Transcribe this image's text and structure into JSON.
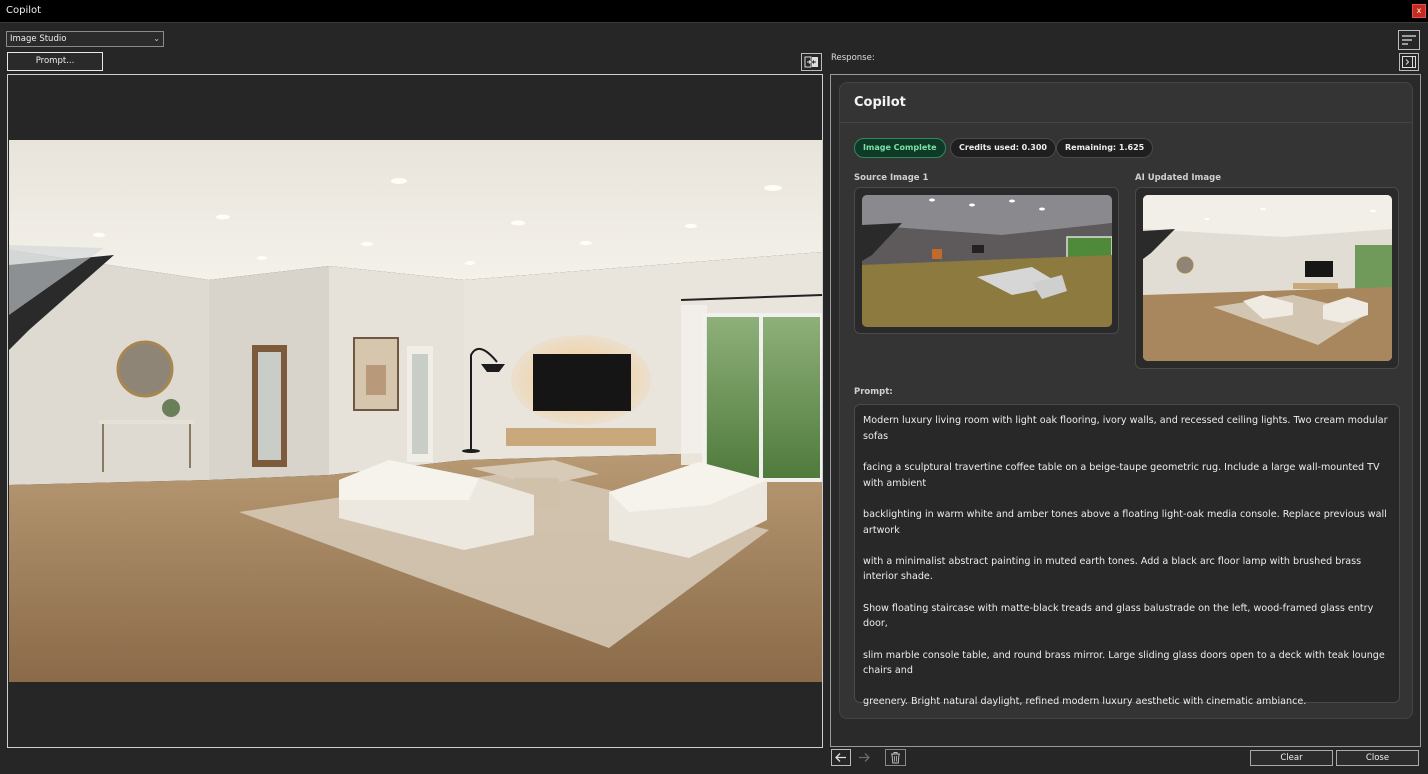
{
  "window": {
    "title": "Copilot",
    "close_glyph": "x"
  },
  "toolbar": {
    "mode_value": "Image Studio",
    "prompt_button": "Prompt..."
  },
  "response": {
    "label": "Response:"
  },
  "card": {
    "title": "Copilot",
    "status": "Image Complete",
    "credits_used": "Credits used: 0.300",
    "remaining": "Remaining: 1.625",
    "source_label": "Source Image 1",
    "ai_label": "AI Updated Image",
    "prompt_label": "Prompt:",
    "prompt_paragraphs": [
      "Modern luxury living room with light oak flooring, ivory walls, and recessed ceiling lights. Two cream modular sofas",
      "facing a sculptural travertine coffee table on a beige-taupe geometric rug. Include a large wall-mounted TV with ambient",
      "backlighting in warm white and amber tones above a floating light-oak media console. Replace previous wall artwork",
      "with a minimalist abstract painting in muted earth tones. Add a black arc floor lamp with brushed brass interior shade.",
      "Show floating staircase with matte-black treads and glass balustrade on the left, wood-framed glass entry door,",
      "slim marble console table, and round brass mirror. Large sliding glass doors open to a deck with teak lounge chairs and",
      "greenery. Bright natural daylight, refined modern luxury aesthetic with cinematic ambiance."
    ]
  },
  "footer": {
    "clear": "Clear",
    "close": "Close"
  },
  "icons": {
    "swap": "swap-panels-icon",
    "sort": "sort-lines-icon",
    "collapse": "collapse-panel-icon",
    "back": "arrow-left-icon",
    "forward": "arrow-right-icon",
    "delete": "trash-icon"
  },
  "colors": {
    "accent_green": "#7de2a8",
    "close_red": "#c42b1c",
    "background": "#262626"
  }
}
